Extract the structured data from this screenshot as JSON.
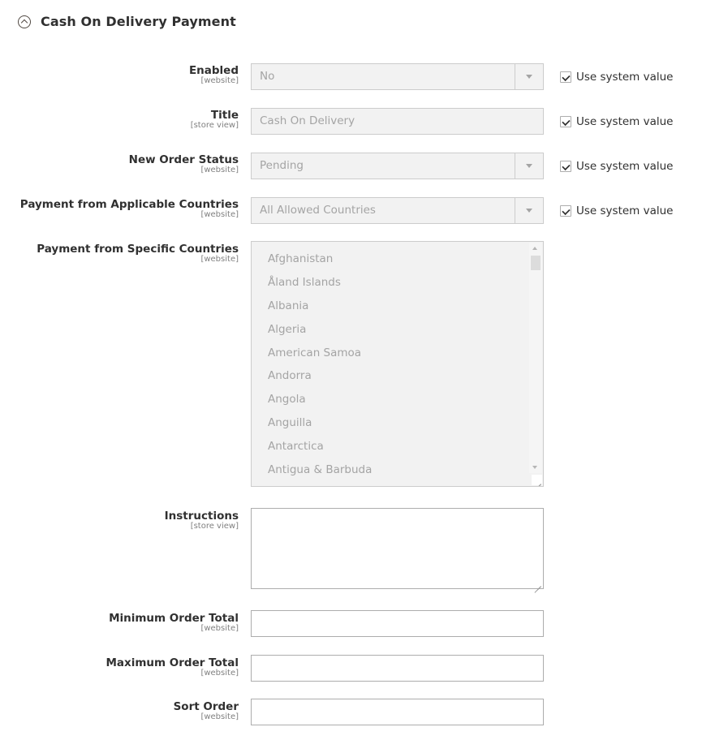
{
  "section": {
    "title": "Cash On Delivery Payment",
    "icon": "collapse-up-icon"
  },
  "fields": {
    "enabled": {
      "label": "Enabled",
      "scope": "[website]",
      "value": "No",
      "use_system_value": true,
      "use_system_value_label": "Use system value"
    },
    "title": {
      "label": "Title",
      "scope": "[store view]",
      "value": "Cash On Delivery",
      "use_system_value": true,
      "use_system_value_label": "Use system value"
    },
    "new_order_status": {
      "label": "New Order Status",
      "scope": "[website]",
      "value": "Pending",
      "use_system_value": true,
      "use_system_value_label": "Use system value"
    },
    "applicable_countries": {
      "label": "Payment from Applicable Countries",
      "scope": "[website]",
      "value": "All Allowed Countries",
      "use_system_value": true,
      "use_system_value_label": "Use system value"
    },
    "specific_countries": {
      "label": "Payment from Specific Countries",
      "scope": "[website]",
      "options": [
        "Afghanistan",
        "Åland Islands",
        "Albania",
        "Algeria",
        "American Samoa",
        "Andorra",
        "Angola",
        "Anguilla",
        "Antarctica",
        "Antigua & Barbuda"
      ]
    },
    "instructions": {
      "label": "Instructions",
      "scope": "[store view]",
      "value": ""
    },
    "min_order_total": {
      "label": "Minimum Order Total",
      "scope": "[website]",
      "value": ""
    },
    "max_order_total": {
      "label": "Maximum Order Total",
      "scope": "[website]",
      "value": ""
    },
    "sort_order": {
      "label": "Sort Order",
      "scope": "[website]",
      "value": ""
    }
  }
}
